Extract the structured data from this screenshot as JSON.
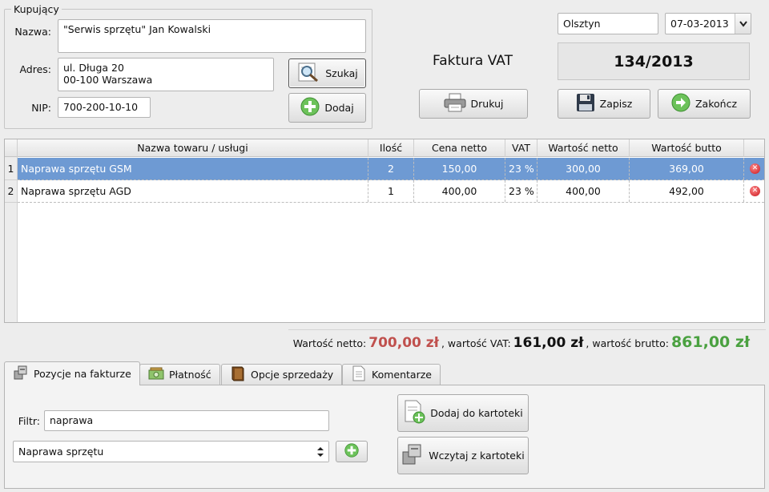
{
  "buyer": {
    "group_title": "Kupujący",
    "name_label": "Nazwa:",
    "name_value": "\"Serwis sprzętu\" Jan Kowalski",
    "address_label": "Adres:",
    "address_value": "ul. Długa 20\n00-100 Warszawa",
    "nip_label": "NIP:",
    "nip_value": "700-200-10-10",
    "search_button": "Szukaj",
    "add_button": "Dodaj"
  },
  "invoice": {
    "city": "Olsztyn",
    "date": "07-03-2013",
    "title": "Faktura VAT",
    "number": "134/2013",
    "print_button": "Drukuj",
    "save_button": "Zapisz",
    "finish_button": "Zakończ"
  },
  "table": {
    "columns": [
      "Nazwa towaru / usługi",
      "Ilość",
      "Cena netto",
      "VAT",
      "Wartość netto",
      "Wartość butto"
    ],
    "rows": [
      {
        "num": "1",
        "name": "Naprawa sprzętu GSM",
        "qty": "2",
        "price": "150,00",
        "vat": "23 %",
        "net": "300,00",
        "gross": "369,00",
        "selected": true
      },
      {
        "num": "2",
        "name": "Naprawa sprzętu AGD",
        "qty": "1",
        "price": "400,00",
        "vat": "23 %",
        "net": "400,00",
        "gross": "492,00",
        "selected": false
      }
    ]
  },
  "totals": {
    "net_label": "Wartość netto:",
    "net_value": "700,00 zł",
    "vat_label": ", wartość VAT:",
    "vat_value": "161,00 zł",
    "gross_label": ", wartość brutto:",
    "gross_value": "861,00 zł"
  },
  "tabs": [
    {
      "label": "Pozycje na fakturze",
      "icon": "boxes-icon",
      "active": true
    },
    {
      "label": "Płatność",
      "icon": "money-icon",
      "active": false
    },
    {
      "label": "Opcje sprzedaży",
      "icon": "book-icon",
      "active": false
    },
    {
      "label": "Komentarze",
      "icon": "document-icon",
      "active": false
    }
  ],
  "panel": {
    "filter_label": "Filtr:",
    "filter_value": "naprawa",
    "category_value": "Naprawa sprzętu",
    "add_to_catalog_button": "Dodaj do kartoteki",
    "load_from_catalog_button": "Wczytaj z kartoteki"
  },
  "colors": {
    "selected_row": "#6e9ad3",
    "net_total": "#c0504d",
    "gross_total": "#4aa140"
  }
}
